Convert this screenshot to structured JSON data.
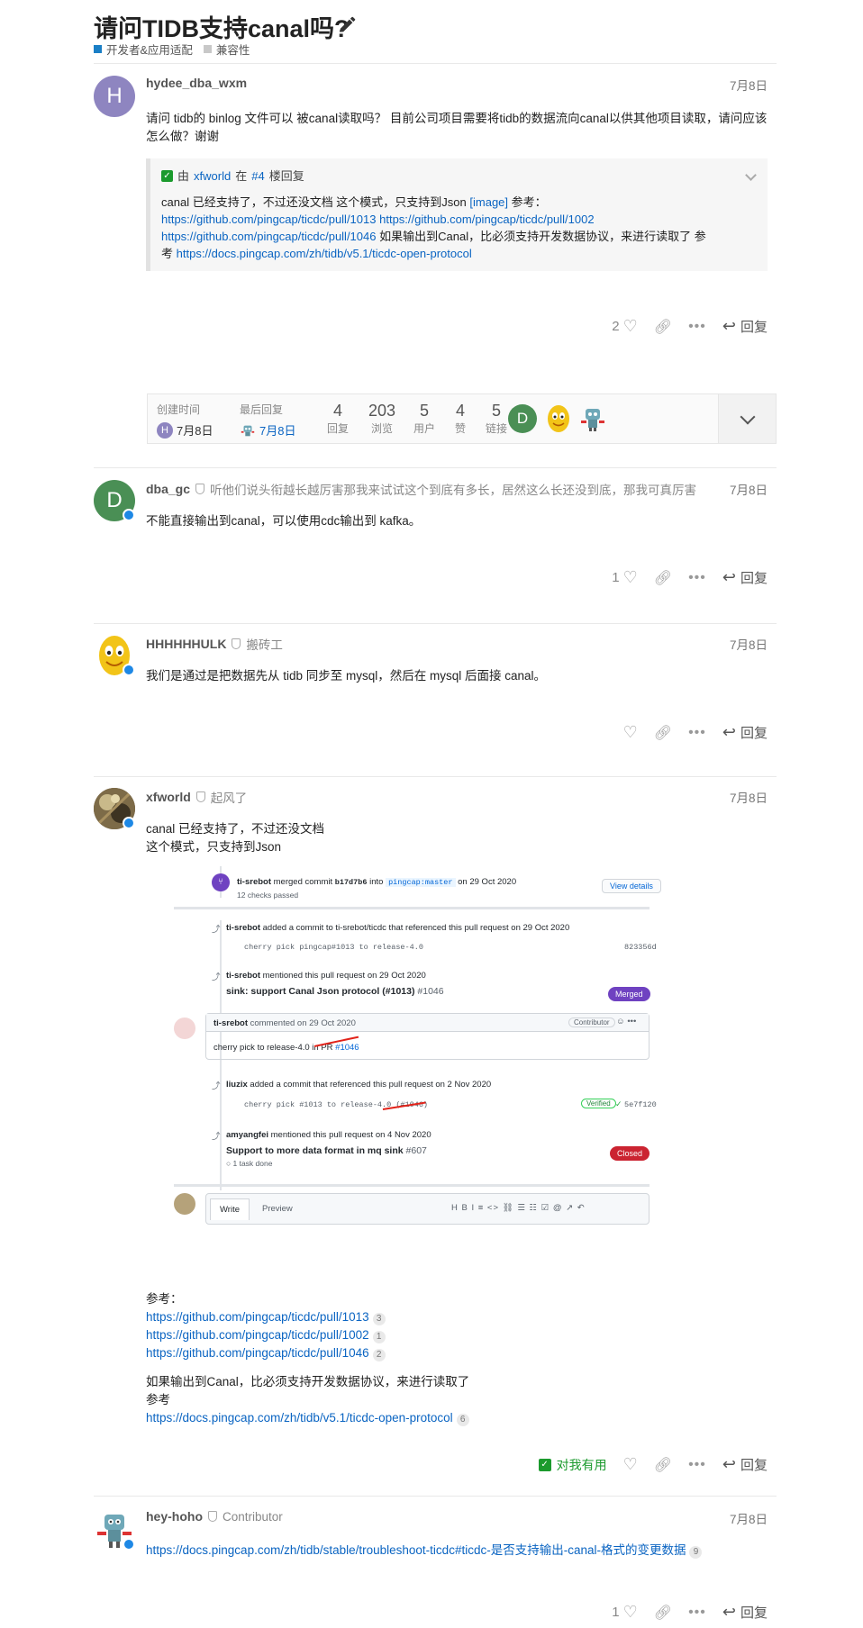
{
  "topic": {
    "title": "请问TIDB支持canal吗?",
    "categories": [
      {
        "label": "开发者&应用适配",
        "color": "#1a7fc6"
      },
      {
        "label": "兼容性",
        "color": "#c8c8c8"
      }
    ]
  },
  "posts": [
    {
      "username": "hydee_dba_wxm",
      "avatar_letter": "H",
      "avatar_color": "#8e85c0",
      "date": "7月8日",
      "body": "请问 tidb的 binlog 文件可以 被canal读取吗？ 目前公司项目需要将tidb的数据流向canal以供其他项目读取，请问应该怎么做？谢谢",
      "quote": {
        "prefix": "由",
        "author": "xfworld",
        "mid": "在",
        "floor": "#4",
        "suffix": "楼回复",
        "line1_text": "canal 已经支持了，不过还没文档 这个模式，只支持到Json",
        "line1_link": "[image]",
        "line1_tail": "参考：",
        "link1": "https://github.com/pingcap/ticdc/pull/1013",
        "link2": "https://github.com/pingcap/ticdc/pull/1002",
        "link3": "https://github.com/pingcap/ticdc/pull/1046",
        "line3_text": "如果输出到Canal，比必须支持开发数据协议，来进行读取了 参",
        "line4_text": "考",
        "link4": "https://docs.pingcap.com/zh/tidb/v5.1/ticdc-open-protocol"
      },
      "likes": "2",
      "reply_label": "回复"
    },
    {
      "username": "dba_gc",
      "avatar_letter": "D",
      "avatar_color": "#4a8f55",
      "user_title": "听他们说头衔越长越厉害那我来试试这个到底有多长，居然这么长还没到底，那我可真厉害",
      "date": "7月8日",
      "body": "不能直接输出到canal，可以使用cdc输出到 kafka。",
      "likes": "1",
      "reply_label": "回复"
    },
    {
      "username": "HHHHHHULK",
      "user_title": "搬砖工",
      "date": "7月8日",
      "body": "我们是通过是把数据先从 tidb 同步至 mysql，然后在 mysql 后面接 canal。",
      "likes": "",
      "reply_label": "回复"
    },
    {
      "username": "xfworld",
      "user_title": "起风了",
      "date": "7月8日",
      "body_line1": "canal 已经支持了，不过还没文档",
      "body_line2": "这个模式，只支持到Json",
      "ref_label": "参考：",
      "links": [
        {
          "url": "https://github.com/pingcap/ticdc/pull/1013",
          "count": "3"
        },
        {
          "url": "https://github.com/pingcap/ticdc/pull/1002",
          "count": "1"
        },
        {
          "url": "https://github.com/pingcap/ticdc/pull/1046",
          "count": "2"
        }
      ],
      "tail_line1": "如果输出到Canal，比必须支持开发数据协议，来进行读取了",
      "tail_line2": "参考",
      "doc_link": "https://docs.pingcap.com/zh/tidb/v5.1/ticdc-open-protocol",
      "doc_count": "6",
      "solution_label": "对我有用",
      "reply_label": "回复"
    },
    {
      "username": "hey-hoho",
      "user_title": "Contributor",
      "date": "7月8日",
      "link": "https://docs.pingcap.com/zh/tidb/stable/troubleshoot-ticdc#ticdc-是否支持输出-canal-格式的变更数据",
      "link_count": "9",
      "likes": "1",
      "reply_label": "回复"
    }
  ],
  "topic_map": {
    "created_label": "创建时间",
    "created_date": "7月8日",
    "created_avatar": "H",
    "last_reply_label": "最后回复",
    "last_reply_date": "7月8日",
    "stats": [
      {
        "num": "4",
        "label": "回复"
      },
      {
        "num": "203",
        "label": "浏览"
      },
      {
        "num": "5",
        "label": "用户"
      },
      {
        "num": "4",
        "label": "赞"
      },
      {
        "num": "5",
        "label": "链接"
      }
    ],
    "participant_letter": "D"
  },
  "embedded_screenshot": {
    "merge_actor": "ti-srebot",
    "merge_text1": "merged commit",
    "merge_sha": "b17d7b6",
    "merge_into": "into",
    "merge_branch": "pingcap:master",
    "merge_date": "on 29 Oct 2020",
    "checks": "12 checks passed",
    "view_details": "View details",
    "e1_actor": "ti-srebot",
    "e1_text": "added a commit to ti-srebot/ticdc that referenced this pull request on 29 Oct 2020",
    "e1_commit": "cherry pick pingcap#1013 to release-4.0",
    "e1_sha": "823356d",
    "e2_actor": "ti-srebot",
    "e2_text": "mentioned this pull request on 29 Oct 2020",
    "e2_title": "sink: support Canal Json protocol (#1013)",
    "e2_num": "#1046",
    "e2_badge": "Merged",
    "c_actor": "ti-srebot",
    "c_text": "commented on 29 Oct 2020",
    "c_role": "Contributor",
    "c_body": "cherry pick to release-4.0 in PR",
    "c_link": "#1046",
    "e3_actor": "liuzix",
    "e3_text": "added a commit that referenced this pull request on 2 Nov 2020",
    "e3_commit": "cherry pick #1013 to release-4.0 (#1046)",
    "e3_verified": "Verified",
    "e3_sha": "5e7f120",
    "e4_actor": "amyangfei",
    "e4_text": "mentioned this pull request on 4 Nov 2020",
    "e4_title": "Support to more data format in mq sink",
    "e4_num": "#607",
    "e4_task": "1 task done",
    "e4_badge": "Closed",
    "tab_write": "Write",
    "tab_preview": "Preview",
    "toolbar": "H  B  I   ≡  <>  ⛓   ☰  ☷  ☑   @  ↗  ↶"
  }
}
